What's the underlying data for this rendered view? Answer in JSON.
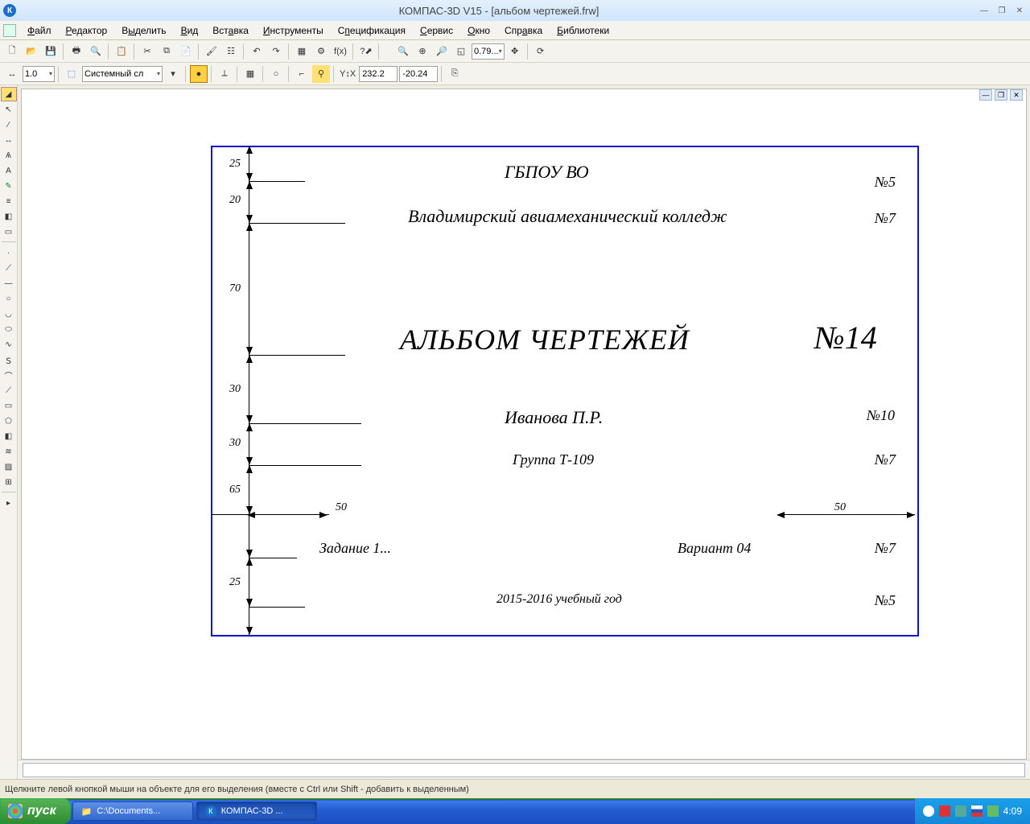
{
  "title": "КОМПАС-3D V15 - [альбом чертежей.frw]",
  "menus": [
    "Файл",
    "Редактор",
    "Выделить",
    "Вид",
    "Вставка",
    "Инструменты",
    "Спецификация",
    "Сервис",
    "Окно",
    "Справка",
    "Библиотеки"
  ],
  "toolbar1": {
    "zoom_value": "0.79..."
  },
  "toolbar2": {
    "step": "1.0",
    "layer": "Системный сл",
    "coord_x": "232.2",
    "coord_y": "-20.24"
  },
  "drawing": {
    "inst_top": "ГБПОУ ВО",
    "inst_name": "Владимирский авиамеханический колледж",
    "title": "АЛЬБОМ   ЧЕРТЕЖЕЙ",
    "author": "Иванова П.Р.",
    "group": "Группа Т-109",
    "task": "Задание 1...",
    "variant": "Вариант 04",
    "year": "2015-2016 учебный год",
    "title_size": "№14",
    "n5": "№5",
    "n7": "№7",
    "n10": "№10",
    "dim_25": "25",
    "dim_20": "20",
    "dim_70": "70",
    "dim_30": "30",
    "dim_65": "65",
    "dim_50": "50"
  },
  "status": "Щелкните левой кнопкой мыши на объекте для его выделения (вместе с Ctrl или Shift - добавить к выделенным)",
  "taskbar": {
    "start": "пуск",
    "item1": "C:\\Documents...",
    "item2": "КОМПАС-3D ...",
    "clock": "4:09"
  }
}
